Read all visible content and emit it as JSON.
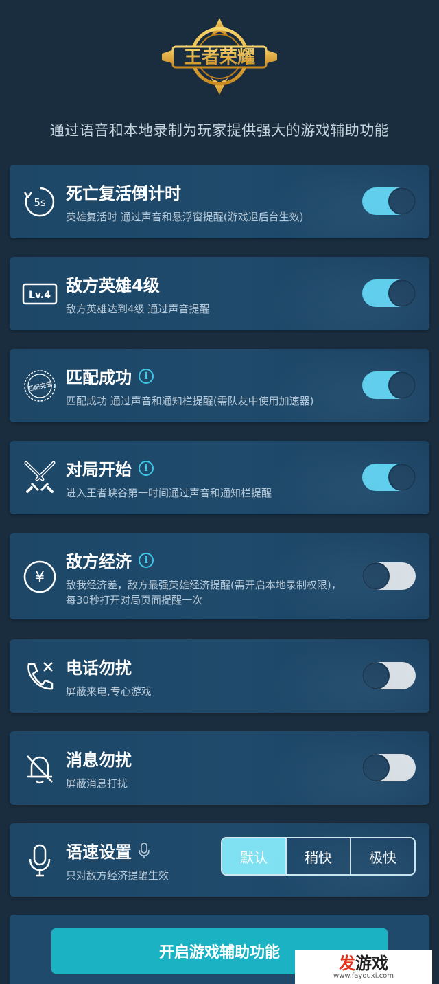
{
  "header": {
    "logo_text": "王者荣耀",
    "subtitle": "通过语音和本地录制为玩家提供强大的游戏辅助功能"
  },
  "colors": {
    "accent": "#5ed1ee",
    "toggle_off": "#dfe3e6",
    "card_bg": "#1f4a6b",
    "page_bg": "#1a2d3e",
    "button": "#1bb3c3"
  },
  "features": [
    {
      "title": "死亡复活倒计时",
      "desc": "英雄复活时 通过声音和悬浮窗提醒(游戏退后台生效)",
      "enabled": true,
      "icon": "revive-timer-icon",
      "icon_text": "5s",
      "info": false
    },
    {
      "title": "敌方英雄4级",
      "desc": "敌方英雄达到4级 通过声音提醒",
      "enabled": true,
      "icon": "level-badge-icon",
      "icon_text": "Lv.4",
      "info": false
    },
    {
      "title": "匹配成功",
      "desc": "匹配成功 通过声音和通知栏提醒(需队友中使用加速器)",
      "enabled": true,
      "icon": "match-stamp-icon",
      "icon_text": "匹配完成",
      "info": true
    },
    {
      "title": "对局开始",
      "desc": "进入王者峡谷第一时间通过声音和通知栏提醒",
      "enabled": true,
      "icon": "crossed-swords-icon",
      "info": true
    },
    {
      "title": "敌方经济",
      "desc": "敌我经济差，敌方最强英雄经济提醒(需开启本地录制权限)，每30秒打开对局页面提醒一次",
      "enabled": false,
      "icon": "coin-yuan-icon",
      "icon_text": "¥",
      "info": true
    },
    {
      "title": "电话勿扰",
      "desc": "屏蔽来电,专心游戏",
      "enabled": false,
      "icon": "phone-blocked-icon",
      "info": false
    },
    {
      "title": "消息勿扰",
      "desc": "屏蔽消息打扰",
      "enabled": false,
      "icon": "bell-muted-icon",
      "info": false
    }
  ],
  "speech": {
    "title": "语速设置",
    "desc": "只对敌方经济提醒生效",
    "icon": "microphone-icon",
    "options": [
      "默认",
      "稍快",
      "极快"
    ],
    "selected": "默认"
  },
  "start_button": "开启游戏辅助功能",
  "watermark": {
    "brand_red": "发",
    "brand_black": "游戏",
    "url": "www.fayouxi.com"
  }
}
